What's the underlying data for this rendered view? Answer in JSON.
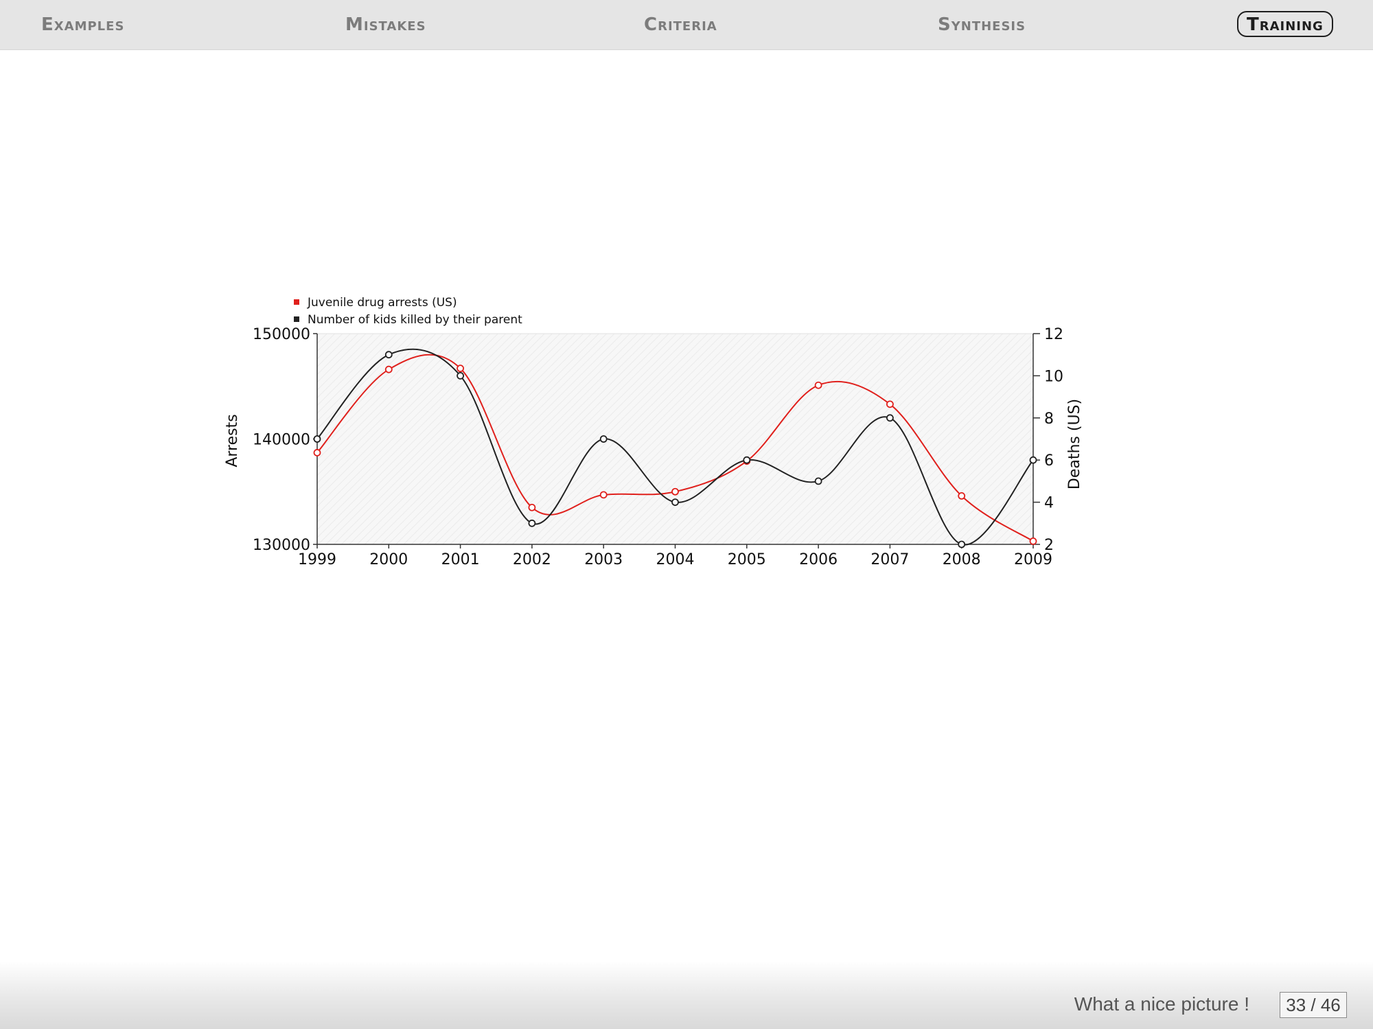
{
  "nav": {
    "items": [
      {
        "label": "Examples"
      },
      {
        "label": "Mistakes"
      },
      {
        "label": "Criteria"
      },
      {
        "label": "Synthesis"
      },
      {
        "label": "Training"
      }
    ],
    "active_index": 4
  },
  "footer": {
    "title": "What a nice picture !",
    "page": "33 / 46"
  },
  "colors": {
    "series_arrests": "#e0201c",
    "series_deaths": "#222222",
    "nav_inactive": "#7c7c7c",
    "nav_active": "#1e1e1e"
  },
  "chart_data": {
    "type": "line",
    "title": "",
    "x": [
      "1999",
      "2000",
      "2001",
      "2002",
      "2003",
      "2004",
      "2005",
      "2006",
      "2007",
      "2008",
      "2009"
    ],
    "xlabel": "",
    "ylabel": "Arrests",
    "ylim": [
      130000,
      150000
    ],
    "y_ticks": [
      "130000",
      "140000",
      "150000"
    ],
    "y2label": "Deaths (US)",
    "y2lim": [
      2,
      12
    ],
    "y2_ticks": [
      "2",
      "4",
      "6",
      "8",
      "10",
      "12"
    ],
    "grid": false,
    "legend_position": "top-left",
    "series": [
      {
        "name": "Juvenile drug arrests (US)",
        "axis": "left",
        "values": [
          138700,
          146600,
          146700,
          133500,
          134700,
          135000,
          137900,
          145100,
          143300,
          134600,
          130300
        ]
      },
      {
        "name": "Number of kids killed by their parent",
        "axis": "right",
        "values": [
          7,
          11,
          10,
          3,
          7,
          4,
          6,
          5,
          8,
          2,
          6
        ]
      }
    ]
  }
}
